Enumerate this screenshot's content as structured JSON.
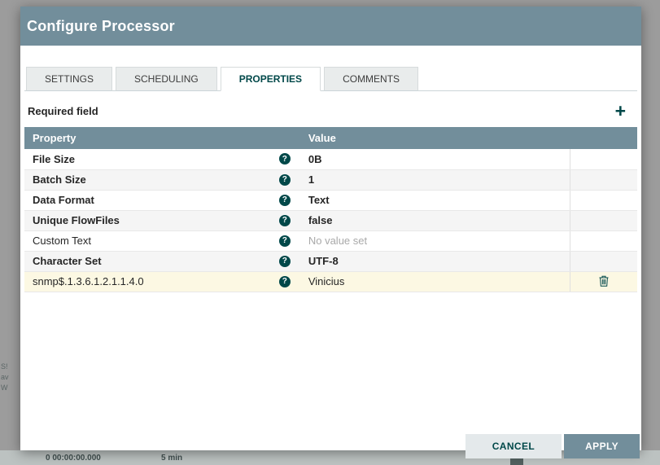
{
  "backdrop": {
    "stats": [
      "0 00:00:00.000",
      "5 min"
    ],
    "fragments": [
      "S!",
      "av",
      "W"
    ]
  },
  "icons": {
    "add": "+",
    "help": "?"
  },
  "dialog": {
    "title": "Configure Processor",
    "tabs": [
      {
        "label": "SETTINGS"
      },
      {
        "label": "SCHEDULING"
      },
      {
        "label": "PROPERTIES"
      },
      {
        "label": "COMMENTS"
      }
    ],
    "active_tab": "PROPERTIES",
    "required_field_label": "Required field",
    "table": {
      "headers": {
        "property": "Property",
        "value": "Value"
      },
      "rows": [
        {
          "name": "File Size",
          "value": "0B",
          "required": true
        },
        {
          "name": "Batch Size",
          "value": "1",
          "required": true
        },
        {
          "name": "Data Format",
          "value": "Text",
          "required": true
        },
        {
          "name": "Unique FlowFiles",
          "value": "false",
          "required": true
        },
        {
          "name": "Custom Text",
          "value": "No value set",
          "required": false,
          "empty": true
        },
        {
          "name": "Character Set",
          "value": "UTF-8",
          "required": true
        },
        {
          "name": "snmp$.1.3.6.1.2.1.1.4.0",
          "value": "Vinicius",
          "required": false,
          "highlighted": true,
          "deletable": true
        }
      ]
    },
    "buttons": {
      "cancel": "CANCEL",
      "apply": "APPLY"
    }
  },
  "colors": {
    "header_bg": "#728e9b",
    "accent": "#004849",
    "highlight_row": "#fcf8e3"
  }
}
